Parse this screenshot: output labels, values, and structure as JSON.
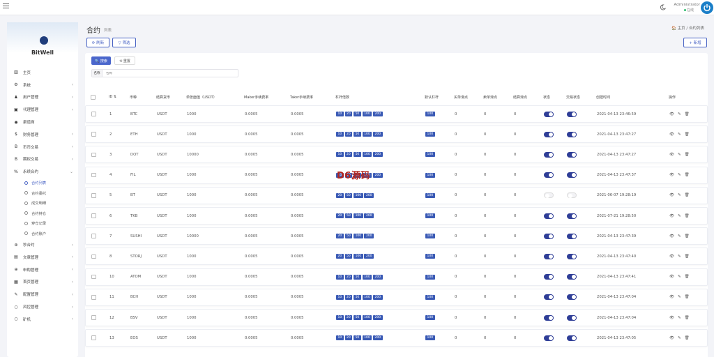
{
  "header": {
    "admin_name": "Administrator",
    "admin_status": "在线"
  },
  "sidebar": {
    "brand": "BitWell",
    "items": [
      {
        "icon": "▥",
        "label": "主页"
      },
      {
        "icon": "⚙",
        "label": "系统",
        "chevron": "‹"
      },
      {
        "icon": "♟",
        "label": "用户管理",
        "chevron": "‹"
      },
      {
        "icon": "▣",
        "label": "代理管理",
        "chevron": "‹"
      },
      {
        "icon": "◉",
        "label": "渠道商"
      },
      {
        "icon": "$",
        "label": "财务管理",
        "chevron": "‹"
      },
      {
        "icon": "B",
        "label": "币币交易",
        "chevron": "‹"
      },
      {
        "icon": "B",
        "label": "期权交易",
        "chevron": "‹"
      },
      {
        "icon": "%",
        "label": "永续合约",
        "chevron": "⌄"
      }
    ],
    "subitems": [
      {
        "label": "合约列表",
        "active": true
      },
      {
        "label": "合约委托"
      },
      {
        "label": "成交明细"
      },
      {
        "label": "合约持仓"
      },
      {
        "label": "穿仓记录"
      },
      {
        "label": "合约账户"
      }
    ],
    "items_after": [
      {
        "icon": "⊛",
        "label": "秒合约",
        "chevron": "‹"
      },
      {
        "icon": "▤",
        "label": "文章管理",
        "chevron": "‹"
      },
      {
        "icon": "⊕",
        "label": "申购管理",
        "chevron": "‹"
      },
      {
        "icon": "▦",
        "label": "首页管理",
        "chevron": "‹"
      },
      {
        "icon": "✎",
        "label": "配置管理",
        "chevron": "‹"
      },
      {
        "icon": "○",
        "label": "风控管理",
        "chevron": "‹"
      },
      {
        "icon": "○",
        "label": "矿机",
        "chevron": "‹"
      }
    ]
  },
  "page": {
    "title": "合约",
    "subtitle": "列表",
    "breadcrumb": "🏠 主页 / 合约列表",
    "refresh_label": "⟳ 刷新",
    "filter_label": "▽ 筛选",
    "add_label": "+ 新增"
  },
  "search": {
    "search_label": "🔍 搜索",
    "reset_label": "⟲ 重置",
    "field_label": "名称",
    "placeholder": "名称"
  },
  "table": {
    "headers": [
      "ID ⇅",
      "币种",
      "结算货币",
      "单张面值（USDT）",
      "Maker手续费率",
      "Taker手续费率",
      "杠杆倍数",
      "默认杠杆",
      "买单滑点",
      "卖单滑点",
      "结算滑点",
      "状态",
      "交易状态",
      "创建时间",
      "操作"
    ],
    "rows": [
      {
        "id": "1",
        "coin": "BTC",
        "settle": "USDT",
        "face": "1000",
        "maker": "0.0005",
        "taker": "0.0005",
        "levers": [
          "10",
          "20",
          "50",
          "100",
          "200"
        ],
        "default": "100",
        "buy": "0",
        "sell": "0",
        "settle_slip": "0",
        "status": true,
        "trade": true,
        "time": "2021-04-13 23:46:59"
      },
      {
        "id": "2",
        "coin": "ETH",
        "settle": "USDT",
        "face": "1000",
        "maker": "0.0005",
        "taker": "0.0005",
        "levers": [
          "10",
          "20",
          "50",
          "100",
          "200"
        ],
        "default": "100",
        "buy": "0",
        "sell": "0",
        "settle_slip": "0",
        "status": true,
        "trade": true,
        "time": "2021-04-13 23:47:27"
      },
      {
        "id": "3",
        "coin": "DOT",
        "settle": "USDT",
        "face": "10000",
        "maker": "0.0005",
        "taker": "0.0005",
        "levers": [
          "10",
          "20",
          "50",
          "100",
          "200"
        ],
        "default": "100",
        "buy": "0",
        "sell": "0",
        "settle_slip": "0",
        "status": true,
        "trade": true,
        "time": "2021-04-13 23:47:27"
      },
      {
        "id": "4",
        "coin": "FIL",
        "settle": "USDT",
        "face": "1000",
        "maker": "0.0005",
        "taker": "0.0005",
        "levers": [
          "10",
          "20",
          "50",
          "100",
          "200"
        ],
        "default": "100",
        "buy": "0",
        "sell": "0",
        "settle_slip": "0",
        "status": true,
        "trade": true,
        "time": "2021-04-13 23:47:37"
      },
      {
        "id": "5",
        "coin": "BT",
        "settle": "USDT",
        "face": "1000",
        "maker": "0.0005",
        "taker": "0.0005",
        "levers": [
          "20",
          "50",
          "100",
          "200"
        ],
        "default": "100",
        "buy": "0",
        "sell": "0",
        "settle_slip": "0",
        "status": false,
        "trade": false,
        "time": "2021-06-07 19:28:19"
      },
      {
        "id": "6",
        "coin": "TKB",
        "settle": "USDT",
        "face": "1000",
        "maker": "0.0005",
        "taker": "0.0005",
        "levers": [
          "20",
          "50",
          "100",
          "200"
        ],
        "default": "100",
        "buy": "0",
        "sell": "0",
        "settle_slip": "0",
        "status": true,
        "trade": true,
        "time": "2021-07-21 19:28:50"
      },
      {
        "id": "7",
        "coin": "SUSHI",
        "settle": "USDT",
        "face": "10000",
        "maker": "0.0005",
        "taker": "0.0005",
        "levers": [
          "20",
          "50",
          "100",
          "200"
        ],
        "default": "100",
        "buy": "0",
        "sell": "0",
        "settle_slip": "0",
        "status": true,
        "trade": true,
        "time": "2021-04-13 23:47:39"
      },
      {
        "id": "8",
        "coin": "STORJ",
        "settle": "USDT",
        "face": "1000",
        "maker": "0.0005",
        "taker": "0.0005",
        "levers": [
          "20",
          "50",
          "100",
          "200"
        ],
        "default": "100",
        "buy": "0",
        "sell": "0",
        "settle_slip": "0",
        "status": true,
        "trade": true,
        "time": "2021-04-13 23:47:40"
      },
      {
        "id": "10",
        "coin": "ATOM",
        "settle": "USDT",
        "face": "1000",
        "maker": "0.0005",
        "taker": "0.0005",
        "levers": [
          "10",
          "20",
          "50",
          "100",
          "200"
        ],
        "default": "100",
        "buy": "0",
        "sell": "0",
        "settle_slip": "0",
        "status": true,
        "trade": true,
        "time": "2021-04-13 23:47:41"
      },
      {
        "id": "11",
        "coin": "BCH",
        "settle": "USDT",
        "face": "1000",
        "maker": "0.0005",
        "taker": "0.0005",
        "levers": [
          "10",
          "20",
          "50",
          "100",
          "200"
        ],
        "default": "100",
        "buy": "0",
        "sell": "0",
        "settle_slip": "0",
        "status": true,
        "trade": true,
        "time": "2021-04-13 23:47:04"
      },
      {
        "id": "12",
        "coin": "BSV",
        "settle": "USDT",
        "face": "1000",
        "maker": "0.0005",
        "taker": "0.0005",
        "levers": [
          "10",
          "20",
          "50",
          "100",
          "200"
        ],
        "default": "100",
        "buy": "0",
        "sell": "0",
        "settle_slip": "0",
        "status": true,
        "trade": true,
        "time": "2021-04-13 23:47:04"
      },
      {
        "id": "13",
        "coin": "EOS",
        "settle": "USDT",
        "face": "1000",
        "maker": "0.0005",
        "taker": "0.0005",
        "levers": [
          "10",
          "20",
          "50",
          "100",
          "200"
        ],
        "default": "100",
        "buy": "0",
        "sell": "0",
        "settle_slip": "0",
        "status": true,
        "trade": true,
        "time": "2021-04-13 23:47:05"
      }
    ],
    "action_icons": [
      "👁",
      "✎",
      "🗑"
    ]
  },
  "watermark": "D6源码",
  "colors": {
    "accent": "#4a66cc",
    "lever_badge": "#3a5ab5",
    "toggle_on": "#2f3e97",
    "online": "#2dbc6d",
    "power": "#1b7fc8"
  }
}
